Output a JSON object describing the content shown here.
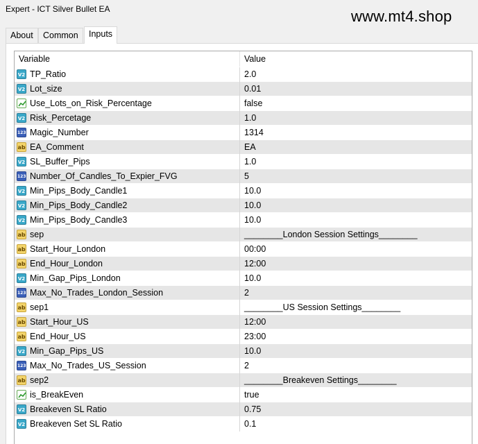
{
  "window": {
    "title": "Expert - ICT Silver Bullet EA",
    "watermark": "www.mt4.shop"
  },
  "tabs": [
    {
      "label": "About",
      "active": false
    },
    {
      "label": "Common",
      "active": false
    },
    {
      "label": "Inputs",
      "active": true
    }
  ],
  "grid": {
    "headers": {
      "variable": "Variable",
      "value": "Value"
    },
    "rows": [
      {
        "icon": "double-icon",
        "name": "TP_Ratio",
        "value": "2.0"
      },
      {
        "icon": "double-icon",
        "name": "Lot_size",
        "value": "0.01"
      },
      {
        "icon": "bool-icon",
        "name": "Use_Lots_on_Risk_Percentage",
        "value": "false"
      },
      {
        "icon": "double-icon",
        "name": "Risk_Percetage",
        "value": "1.0"
      },
      {
        "icon": "int-icon",
        "name": "Magic_Number",
        "value": "1314"
      },
      {
        "icon": "string-icon",
        "name": "EA_Comment",
        "value": "EA"
      },
      {
        "icon": "double-icon",
        "name": "SL_Buffer_Pips",
        "value": "1.0"
      },
      {
        "icon": "int-icon",
        "name": "Number_Of_Candles_To_Expier_FVG",
        "value": "5"
      },
      {
        "icon": "double-icon",
        "name": "Min_Pips_Body_Candle1",
        "value": "10.0"
      },
      {
        "icon": "double-icon",
        "name": "Min_Pips_Body_Candle2",
        "value": "10.0"
      },
      {
        "icon": "double-icon",
        "name": "Min_Pips_Body_Candle3",
        "value": "10.0"
      },
      {
        "icon": "string-icon",
        "name": "sep",
        "value": "________London Session Settings________"
      },
      {
        "icon": "string-icon",
        "name": "Start_Hour_London",
        "value": "00:00"
      },
      {
        "icon": "string-icon",
        "name": "End_Hour_London",
        "value": "12:00"
      },
      {
        "icon": "double-icon",
        "name": "Min_Gap_Pips_London",
        "value": "10.0"
      },
      {
        "icon": "int-icon",
        "name": "Max_No_Trades_London_Session",
        "value": "2"
      },
      {
        "icon": "string-icon",
        "name": "sep1",
        "value": "________US Session Settings________"
      },
      {
        "icon": "string-icon",
        "name": "Start_Hour_US",
        "value": "12:00"
      },
      {
        "icon": "string-icon",
        "name": "End_Hour_US",
        "value": "23:00"
      },
      {
        "icon": "double-icon",
        "name": "Min_Gap_Pips_US",
        "value": "10.0"
      },
      {
        "icon": "int-icon",
        "name": "Max_No_Trades_US_Session",
        "value": "2"
      },
      {
        "icon": "string-icon",
        "name": "sep2",
        "value": "________Breakeven Settings________"
      },
      {
        "icon": "bool-icon",
        "name": "is_BreakEven",
        "value": "true"
      },
      {
        "icon": "double-icon",
        "name": "Breakeven SL Ratio",
        "value": "0.75"
      },
      {
        "icon": "double-icon",
        "name": "Breakeven Set SL Ratio",
        "value": "0.1"
      }
    ]
  }
}
